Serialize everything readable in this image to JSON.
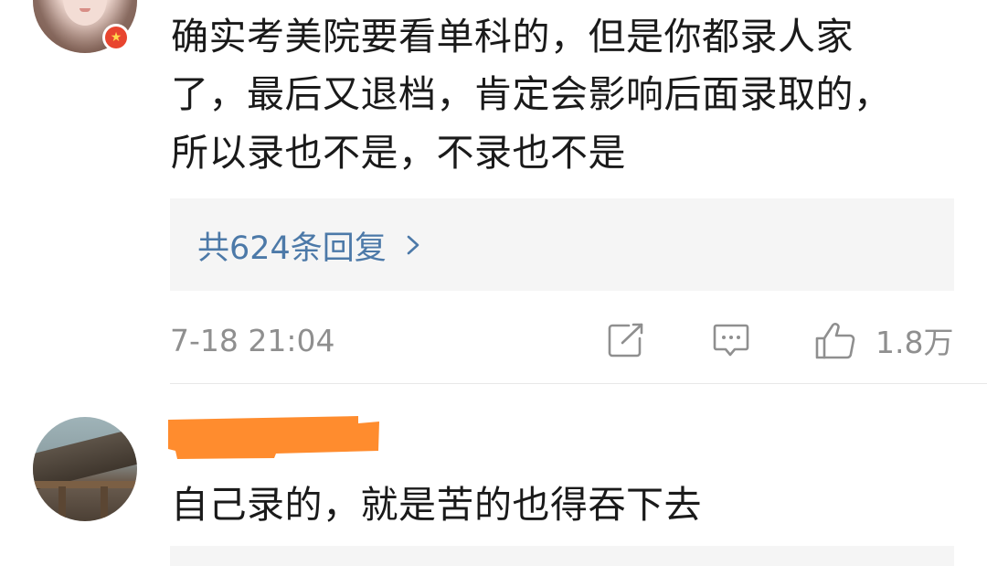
{
  "comments": [
    {
      "text_lines": [
        "确实考美院要看单科的，但是你都录人家",
        "了，最后又退档，肯定会影响后面录取的，",
        "所以录也不是，不录也不是"
      ],
      "badge_icon": "star-icon",
      "replies_label": "共624条回复",
      "timestamp": "7-18 21:04",
      "like_count": "1.8万",
      "colors": {
        "text": "#1a1a1a",
        "link": "#4c79a8",
        "meta": "#8f8f8f",
        "reply_bg": "#f5f5f5"
      }
    },
    {
      "username_redaction_color": "#ff8c2e",
      "text_lines": [
        "自己录的，就是苦的也得吞下去"
      ]
    }
  ]
}
